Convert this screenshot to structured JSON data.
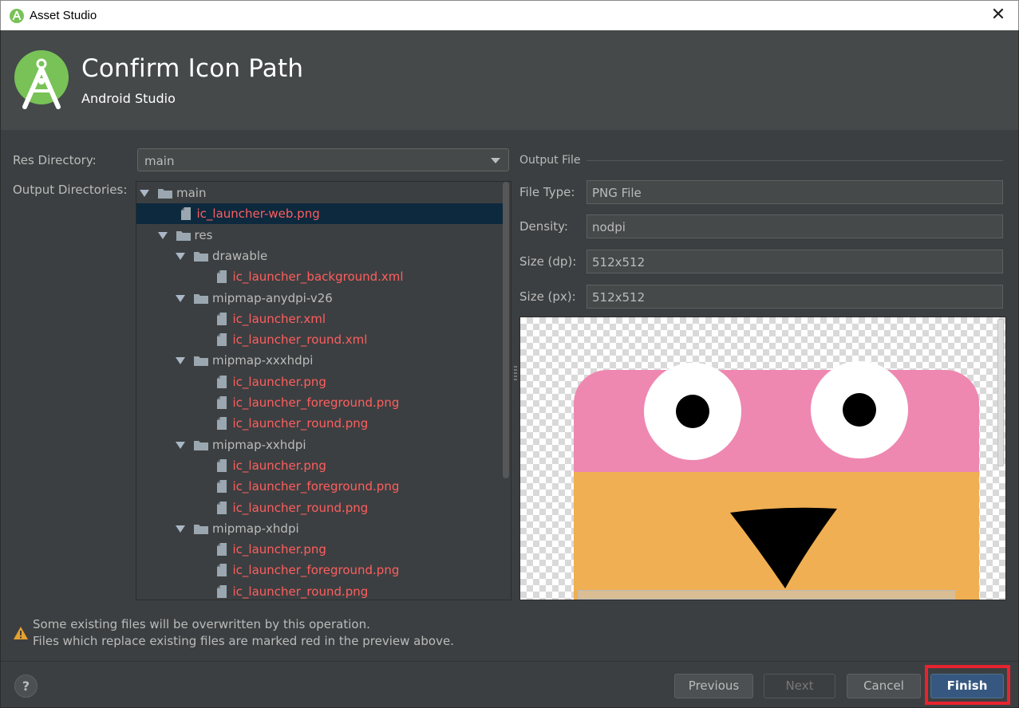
{
  "window": {
    "title": "Asset Studio",
    "close_glyph": "✕"
  },
  "header": {
    "title": "Confirm Icon Path",
    "subtitle": "Android Studio",
    "logo_icon": "android-studio-logo"
  },
  "form": {
    "res_directory_label": "Res Directory:",
    "res_directory_value": "main",
    "output_directories_label": "Output Directories:"
  },
  "tree": [
    {
      "label": "main",
      "kind": "folder",
      "depth": 0,
      "red": false
    },
    {
      "label": "ic_launcher-web.png",
      "kind": "file",
      "depth": 1,
      "red": true,
      "selected": true
    },
    {
      "label": "res",
      "kind": "folder",
      "depth": 1,
      "red": false
    },
    {
      "label": "drawable",
      "kind": "folder",
      "depth": 2,
      "red": false
    },
    {
      "label": "ic_launcher_background.xml",
      "kind": "file",
      "depth": 3,
      "red": true
    },
    {
      "label": "mipmap-anydpi-v26",
      "kind": "folder",
      "depth": 2,
      "red": false
    },
    {
      "label": "ic_launcher.xml",
      "kind": "file",
      "depth": 3,
      "red": true
    },
    {
      "label": "ic_launcher_round.xml",
      "kind": "file",
      "depth": 3,
      "red": true
    },
    {
      "label": "mipmap-xxxhdpi",
      "kind": "folder",
      "depth": 2,
      "red": false
    },
    {
      "label": "ic_launcher.png",
      "kind": "file",
      "depth": 3,
      "red": true
    },
    {
      "label": "ic_launcher_foreground.png",
      "kind": "file",
      "depth": 3,
      "red": true
    },
    {
      "label": "ic_launcher_round.png",
      "kind": "file",
      "depth": 3,
      "red": true
    },
    {
      "label": "mipmap-xxhdpi",
      "kind": "folder",
      "depth": 2,
      "red": false
    },
    {
      "label": "ic_launcher.png",
      "kind": "file",
      "depth": 3,
      "red": true
    },
    {
      "label": "ic_launcher_foreground.png",
      "kind": "file",
      "depth": 3,
      "red": true
    },
    {
      "label": "ic_launcher_round.png",
      "kind": "file",
      "depth": 3,
      "red": true
    },
    {
      "label": "mipmap-xhdpi",
      "kind": "folder",
      "depth": 2,
      "red": false
    },
    {
      "label": "ic_launcher.png",
      "kind": "file",
      "depth": 3,
      "red": true
    },
    {
      "label": "ic_launcher_foreground.png",
      "kind": "file",
      "depth": 3,
      "red": true
    },
    {
      "label": "ic_launcher_round.png",
      "kind": "file",
      "depth": 3,
      "red": true
    }
  ],
  "output_file": {
    "section_title": "Output File",
    "file_type_label": "File Type:",
    "file_type_value": "PNG File",
    "density_label": "Density:",
    "density_value": "nodpi",
    "size_dp_label": "Size (dp):",
    "size_dp_value": "512x512",
    "size_px_label": "Size (px):",
    "size_px_value": "512x512"
  },
  "warning": {
    "line1": "Some existing files will be overwritten by this operation.",
    "line2": "Files which replace existing files are marked red in the preview above."
  },
  "footer": {
    "help_label": "?",
    "previous_label": "Previous",
    "next_label": "Next",
    "cancel_label": "Cancel",
    "finish_label": "Finish"
  },
  "colors": {
    "background": "#3c3f41",
    "header": "#45494a",
    "red_file": "#ff5e5e",
    "selection": "#0d293e",
    "primary_button": "#365880",
    "highlight_box": "#e8232f",
    "icon_pink": "#ee88b0",
    "icon_orange": "#f0af52"
  }
}
